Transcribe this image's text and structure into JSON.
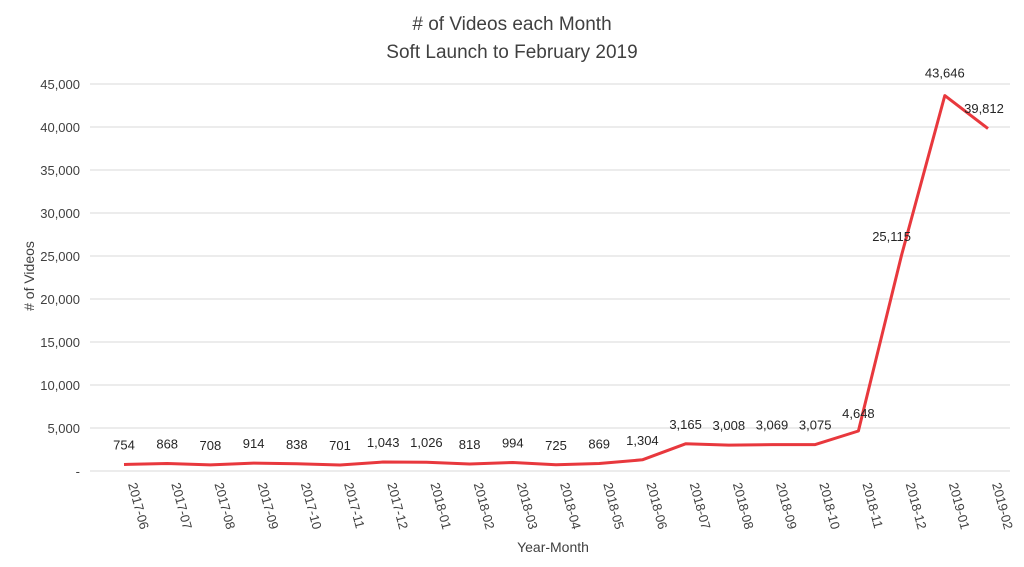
{
  "colors": {
    "line": "#e8383d",
    "grid": "#d9d9d9",
    "text": "#404040"
  },
  "chart_data": {
    "type": "line",
    "title": "# of Videos each Month",
    "subtitle": "Soft Launch to February 2019",
    "xlabel": "Year-Month",
    "ylabel": "# of Videos",
    "ylim": [
      0,
      45000
    ],
    "ytick_values": [
      0,
      5000,
      10000,
      15000,
      20000,
      25000,
      30000,
      35000,
      40000,
      45000
    ],
    "ytick_labels": [
      "-",
      "5,000",
      "10,000",
      "15,000",
      "20,000",
      "25,000",
      "30,000",
      "35,000",
      "40,000",
      "45,000"
    ],
    "grid": true,
    "legend": "none",
    "categories": [
      "2017-06",
      "2017-07",
      "2017-08",
      "2017-09",
      "2017-10",
      "2017-11",
      "2017-12",
      "2018-01",
      "2018-02",
      "2018-03",
      "2018-04",
      "2018-05",
      "2018-06",
      "2018-07",
      "2018-08",
      "2018-09",
      "2018-10",
      "2018-11",
      "2018-12",
      "2019-01",
      "2019-02"
    ],
    "series": [
      {
        "values": [
          754,
          868,
          708,
          914,
          838,
          701,
          1043,
          1026,
          818,
          994,
          725,
          869,
          1304,
          3165,
          3008,
          3069,
          3075,
          4648,
          25115,
          43646,
          39812
        ],
        "labels": [
          "754",
          "868",
          "708",
          "914",
          "838",
          "701",
          "1,043",
          "1,026",
          "818",
          "994",
          "725",
          "869",
          "1,304",
          "3,165",
          "3,008",
          "3,069",
          "3,075",
          "4,648",
          "25,115",
          "43,646",
          "39,812"
        ]
      }
    ]
  }
}
